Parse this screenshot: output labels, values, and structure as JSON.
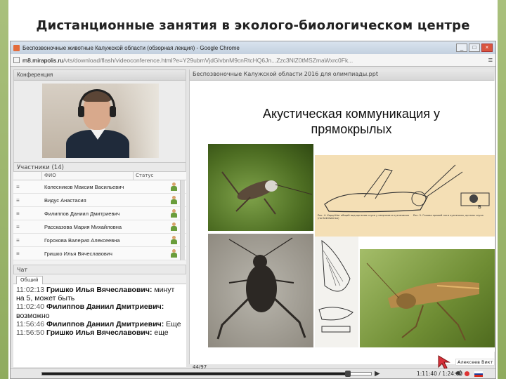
{
  "slide": {
    "title": "Дистанционные занятия в эколого-биологическом центре"
  },
  "browser": {
    "window_title": "Беспозвоночные животные Калужской области (обзорная лекция) - Google Chrome",
    "url_host": "m8.mirapolis.ru",
    "url_rest": "/vts/download/flash/videoconference.html?e=Y29ubmVjdGlvbnM9cnRtcHQ6Jn...Zzc3NlZ0tMSZmaWxrc0Fk..."
  },
  "conference": {
    "panel_label": "Конференция",
    "participants_label": "Участники (14)",
    "columns": {
      "fio": "ФИО",
      "status": "Статус"
    },
    "participants": [
      "Колесников Максим Васильевич",
      "Видус Анастасия",
      "Филиппов Даниил Дмитриевич",
      "Рассказова Мария Михайловна",
      "Горохова Валерия Алексеевна",
      "Гришко Илья Вячеславович"
    ],
    "chat_label": "Чат",
    "chat_tab": "Общий",
    "chat_messages": [
      {
        "time": "11:02:13",
        "author": "Гришко Илья Вячеславович:",
        "text": "минут на 5, может быть"
      },
      {
        "time": "11:02:40",
        "author": "Филиппов Даниил Дмитриевич:",
        "text": "возможно"
      },
      {
        "time": "11:56:46",
        "author": "Филиппов Даниил Дмитриевич:",
        "text": "Еще"
      },
      {
        "time": "11:56:50",
        "author": "Гришко Илья Вячеславович:",
        "text": "еще"
      }
    ]
  },
  "presentation": {
    "panel_label": "Беспозвоночные Калужской области 2016 для олимпиады.ppt",
    "heading": "Акустическая коммуникация у прямокрылых",
    "presenter": "Алексеев Викт",
    "page_counter": "44/97",
    "figure_label": "B"
  },
  "player": {
    "progress": 0.93,
    "time": "1:11:40 / 1:24:00"
  },
  "colors": {
    "slide_edge": "#8fab5e",
    "flag": [
      "#ffffff",
      "#1c3f9e",
      "#d52b1e"
    ]
  },
  "icons": {
    "window_controls": [
      "minimize-icon",
      "maximize-icon",
      "close-icon"
    ],
    "participant_status": "user-icon",
    "play": "play-icon",
    "volume": "volume-icon"
  }
}
